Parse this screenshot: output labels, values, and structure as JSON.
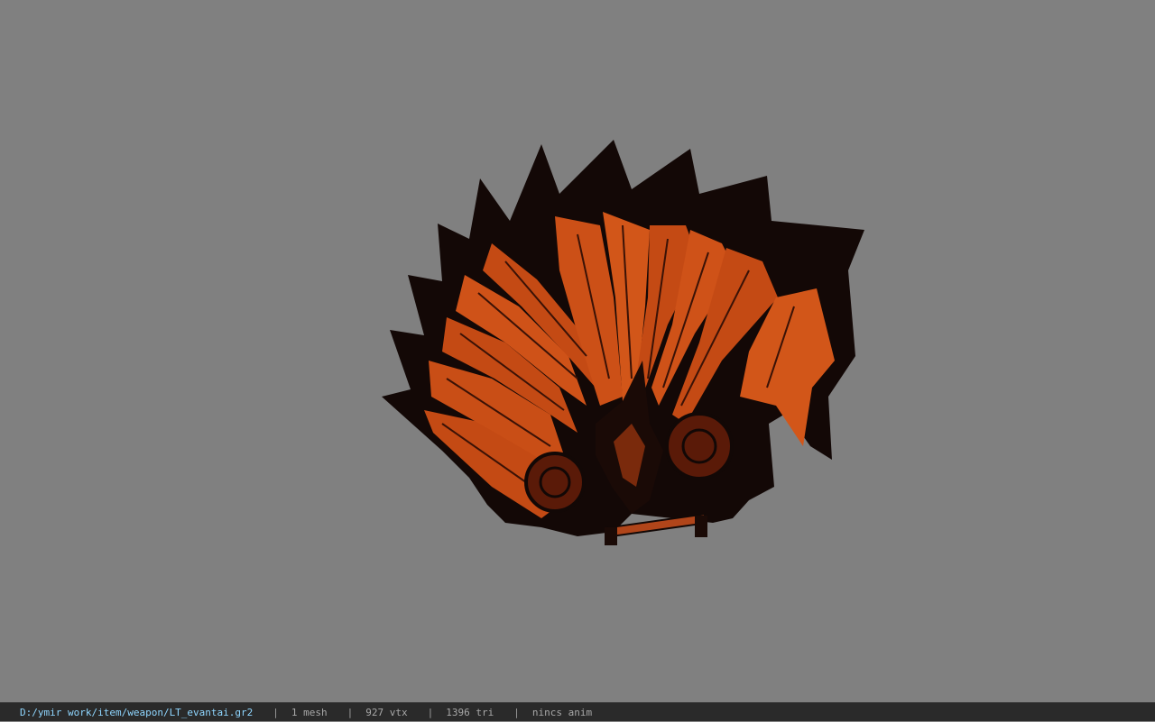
{
  "viewport": {
    "background_color": "#808080",
    "model_icon": "fan-weapon-model-icon",
    "model_colors": {
      "blade": "#c44a14",
      "blade_highlight": "#e06a28",
      "edge": "#120806",
      "detail": "#3a1206"
    }
  },
  "statusbar": {
    "path": "D:/ymir work/item/weapon/LT_evantai.gr2",
    "separator": "|",
    "mesh": "1 mesh",
    "vtx": "927 vtx",
    "tri": "1396 tri",
    "anim": "nincs anim",
    "path_color": "#8fd6ff",
    "text_color": "#a8a8a8",
    "background_color": "#2a2a2a"
  }
}
